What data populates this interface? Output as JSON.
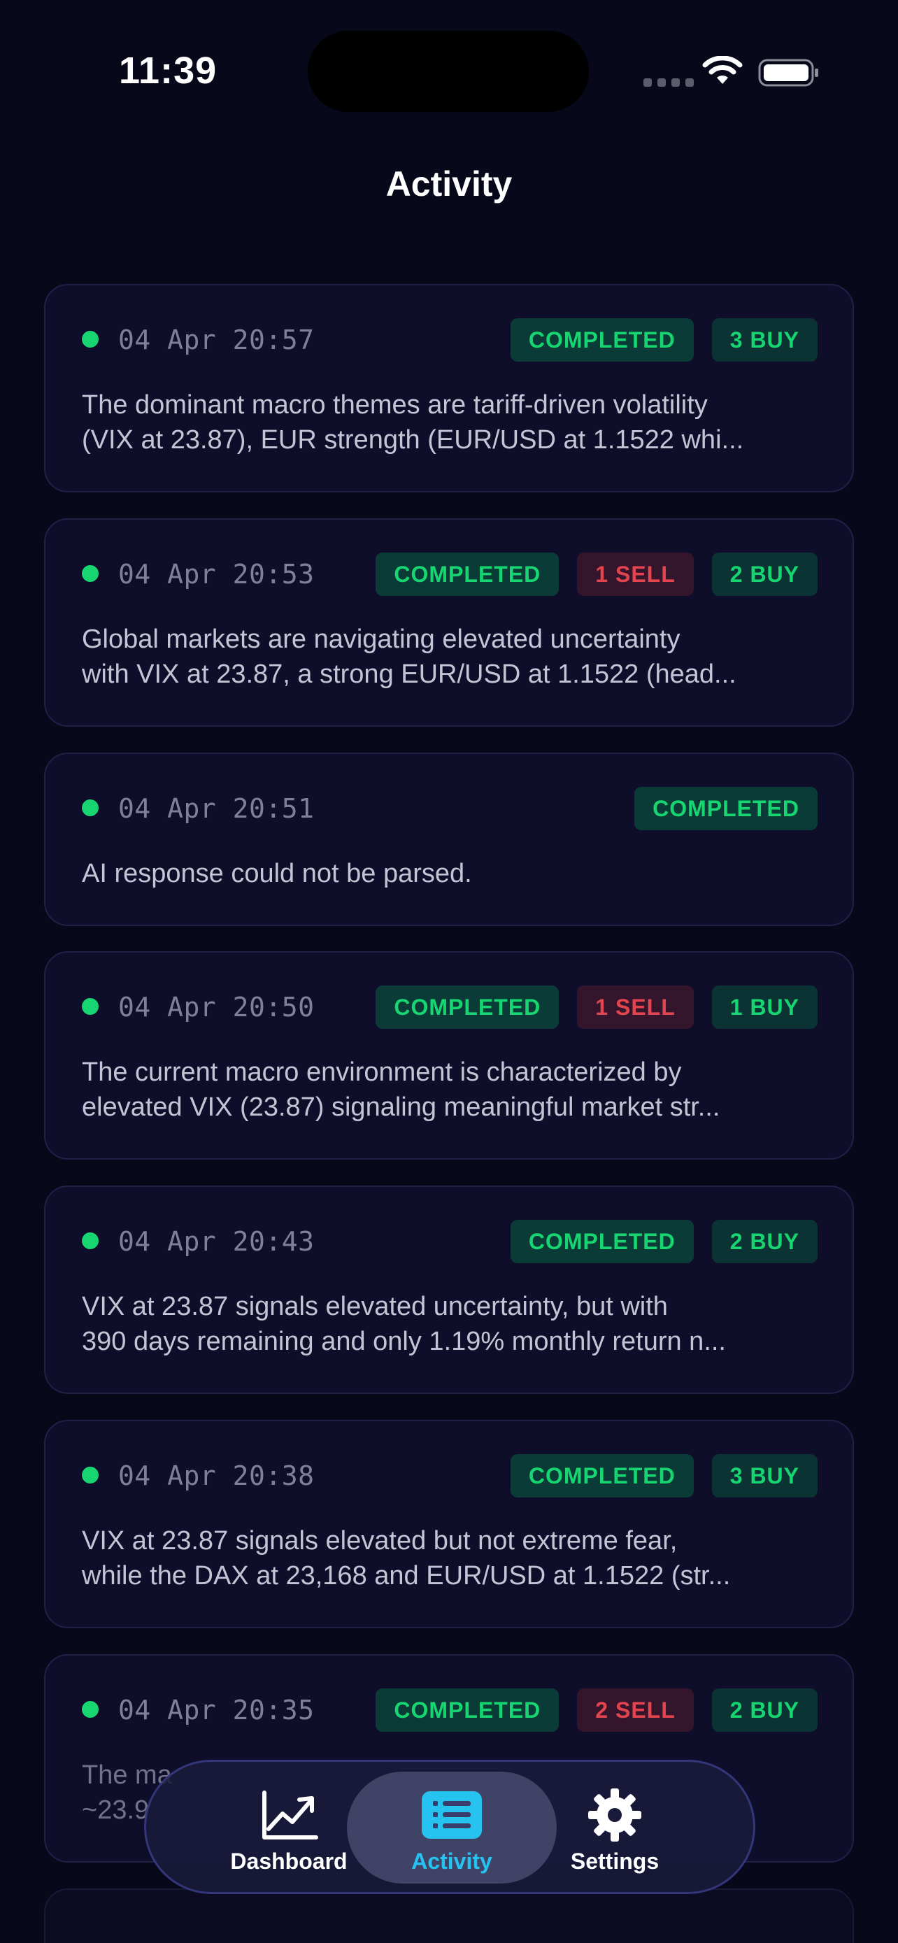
{
  "status_bar": {
    "time": "11:39"
  },
  "header": {
    "title": "Activity"
  },
  "colors": {
    "background": "#07081a",
    "card": "#0e0e2a",
    "accent_green": "#17d672",
    "accent_red": "#e2454e",
    "active_tab": "#27c3f0"
  },
  "activities": [
    {
      "date": "04 Apr 20:57",
      "status": "COMPLETED",
      "sell": "",
      "buy": "3 BUY",
      "line1": "The dominant macro themes are tariff-driven volatility",
      "line2": "(VIX at 23.87), EUR strength (EUR/USD at 1.1522 whi..."
    },
    {
      "date": "04 Apr 20:53",
      "status": "COMPLETED",
      "sell": "1 SELL",
      "buy": "2 BUY",
      "line1": "Global markets are navigating elevated uncertainty",
      "line2": "with VIX at 23.87, a strong EUR/USD at 1.1522 (head..."
    },
    {
      "date": "04 Apr 20:51",
      "status": "COMPLETED",
      "sell": "",
      "buy": "",
      "line1": "AI response could not be parsed.",
      "line2": ""
    },
    {
      "date": "04 Apr 20:50",
      "status": "COMPLETED",
      "sell": "1 SELL",
      "buy": "1 BUY",
      "line1": "The current macro environment is characterized by",
      "line2": "elevated VIX (23.87) signaling meaningful market str..."
    },
    {
      "date": "04 Apr 20:43",
      "status": "COMPLETED",
      "sell": "",
      "buy": "2 BUY",
      "line1": "VIX at 23.87 signals elevated uncertainty, but with",
      "line2": "390 days remaining and only 1.19% monthly return n..."
    },
    {
      "date": "04 Apr 20:38",
      "status": "COMPLETED",
      "sell": "",
      "buy": "3 BUY",
      "line1": "VIX at 23.87 signals elevated but not extreme fear,",
      "line2": "while the DAX at 23,168 and EUR/USD at 1.1522 (str..."
    },
    {
      "date": "04 Apr 20:35",
      "status": "COMPLETED",
      "sell": "2 SELL",
      "buy": "2 BUY",
      "line1": "The ma",
      "line2": "~23.9"
    }
  ],
  "tab_bar": {
    "tabs": [
      {
        "label": "Dashboard",
        "icon": "chart-trend-icon"
      },
      {
        "label": "Activity",
        "icon": "list-icon"
      },
      {
        "label": "Settings",
        "icon": "gear-icon"
      }
    ],
    "active": "Activity"
  }
}
